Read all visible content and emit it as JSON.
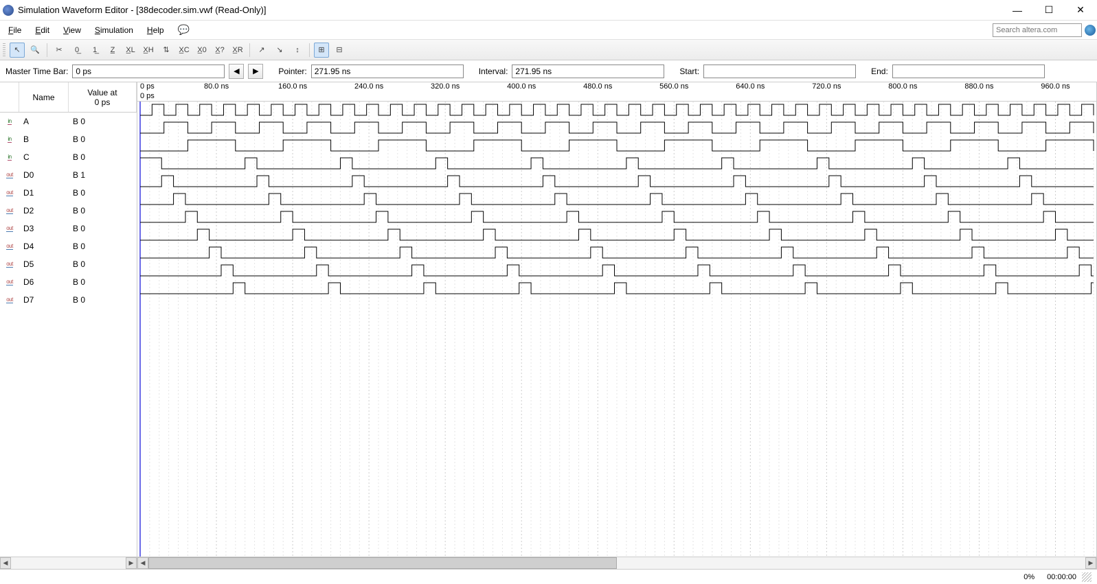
{
  "window": {
    "title": "Simulation Waveform Editor - [38decoder.sim.vwf (Read-Only)]"
  },
  "menus": {
    "file": "File",
    "edit": "Edit",
    "view": "View",
    "simulation": "Simulation",
    "help": "Help"
  },
  "search": {
    "placeholder": "Search altera.com"
  },
  "toolbar": {
    "buttons": [
      "pointer",
      "zoom",
      "x-cut",
      "0",
      "1",
      "z",
      "xL",
      "xH",
      "inv",
      "xC",
      "x0",
      "x?",
      "xR",
      "edge-up",
      "edge-dn",
      "edge-both",
      "snap",
      "grid"
    ]
  },
  "infobar": {
    "master_label": "Master Time Bar:",
    "master_value": "0 ps",
    "pointer_label": "Pointer:",
    "pointer_value": "271.95 ns",
    "interval_label": "Interval:",
    "interval_value": "271.95 ns",
    "start_label": "Start:",
    "start_value": "",
    "end_label": "End:",
    "end_value": ""
  },
  "signal_headers": {
    "name": "Name",
    "value_at": "Value at",
    "value_at_sub": "0 ps"
  },
  "signals": [
    {
      "dir": "in",
      "name": "A",
      "value": "B 0",
      "period": 25,
      "phase": 0
    },
    {
      "dir": "in",
      "name": "B",
      "value": "B 0",
      "period": 50,
      "phase": 0
    },
    {
      "dir": "in",
      "name": "C",
      "value": "B 0",
      "period": 100,
      "phase": 0
    },
    {
      "dir": "out",
      "name": "D0",
      "value": "B 1",
      "decode": 0,
      "delay": 10
    },
    {
      "dir": "out",
      "name": "D1",
      "value": "B 0",
      "decode": 1,
      "delay": 10
    },
    {
      "dir": "out",
      "name": "D2",
      "value": "B 0",
      "decode": 2,
      "delay": 10
    },
    {
      "dir": "out",
      "name": "D3",
      "value": "B 0",
      "decode": 3,
      "delay": 10
    },
    {
      "dir": "out",
      "name": "D4",
      "value": "B 0",
      "decode": 4,
      "delay": 10
    },
    {
      "dir": "out",
      "name": "D5",
      "value": "B 0",
      "decode": 5,
      "delay": 10
    },
    {
      "dir": "out",
      "name": "D6",
      "value": "B 0",
      "decode": 6,
      "delay": 10
    },
    {
      "dir": "out",
      "name": "D7",
      "value": "B 0",
      "decode": 7,
      "delay": 10
    }
  ],
  "ruler": {
    "origin": "0 ps",
    "origin2": "0 ps",
    "ticks": [
      "80.0 ns",
      "160.0 ns",
      "240.0 ns",
      "320.0 ns",
      "400.0 ns",
      "480.0 ns",
      "560.0 ns",
      "640.0 ns",
      "720.0 ns",
      "800.0 ns",
      "880.0 ns",
      "960.0 ns"
    ],
    "tick_values_ns": [
      80,
      160,
      240,
      320,
      400,
      480,
      560,
      640,
      720,
      800,
      880,
      960
    ],
    "total_ns": 1000
  },
  "statusbar": {
    "percent": "0%",
    "elapsed": "00:00:00"
  }
}
